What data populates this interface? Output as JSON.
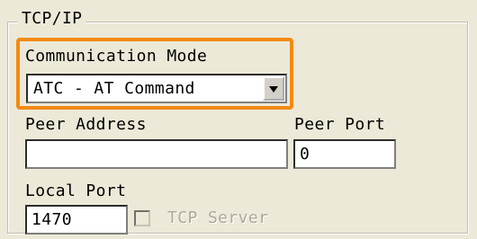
{
  "group": {
    "title": "TCP/IP"
  },
  "communication_mode": {
    "label": "Communication Mode",
    "selected": "ATC - AT Command",
    "icon": "chevron-down-icon"
  },
  "peer_address": {
    "label": "Peer Address",
    "value": ""
  },
  "peer_port": {
    "label": "Peer Port",
    "value": "0"
  },
  "local_port": {
    "label": "Local Port",
    "value": "1470"
  },
  "tcp_server": {
    "label": "TCP Server",
    "checked": false,
    "enabled": false
  },
  "colors": {
    "highlight": "#f38a13",
    "panel_background": "#ece9d8",
    "disabled_text": "#aca899"
  }
}
